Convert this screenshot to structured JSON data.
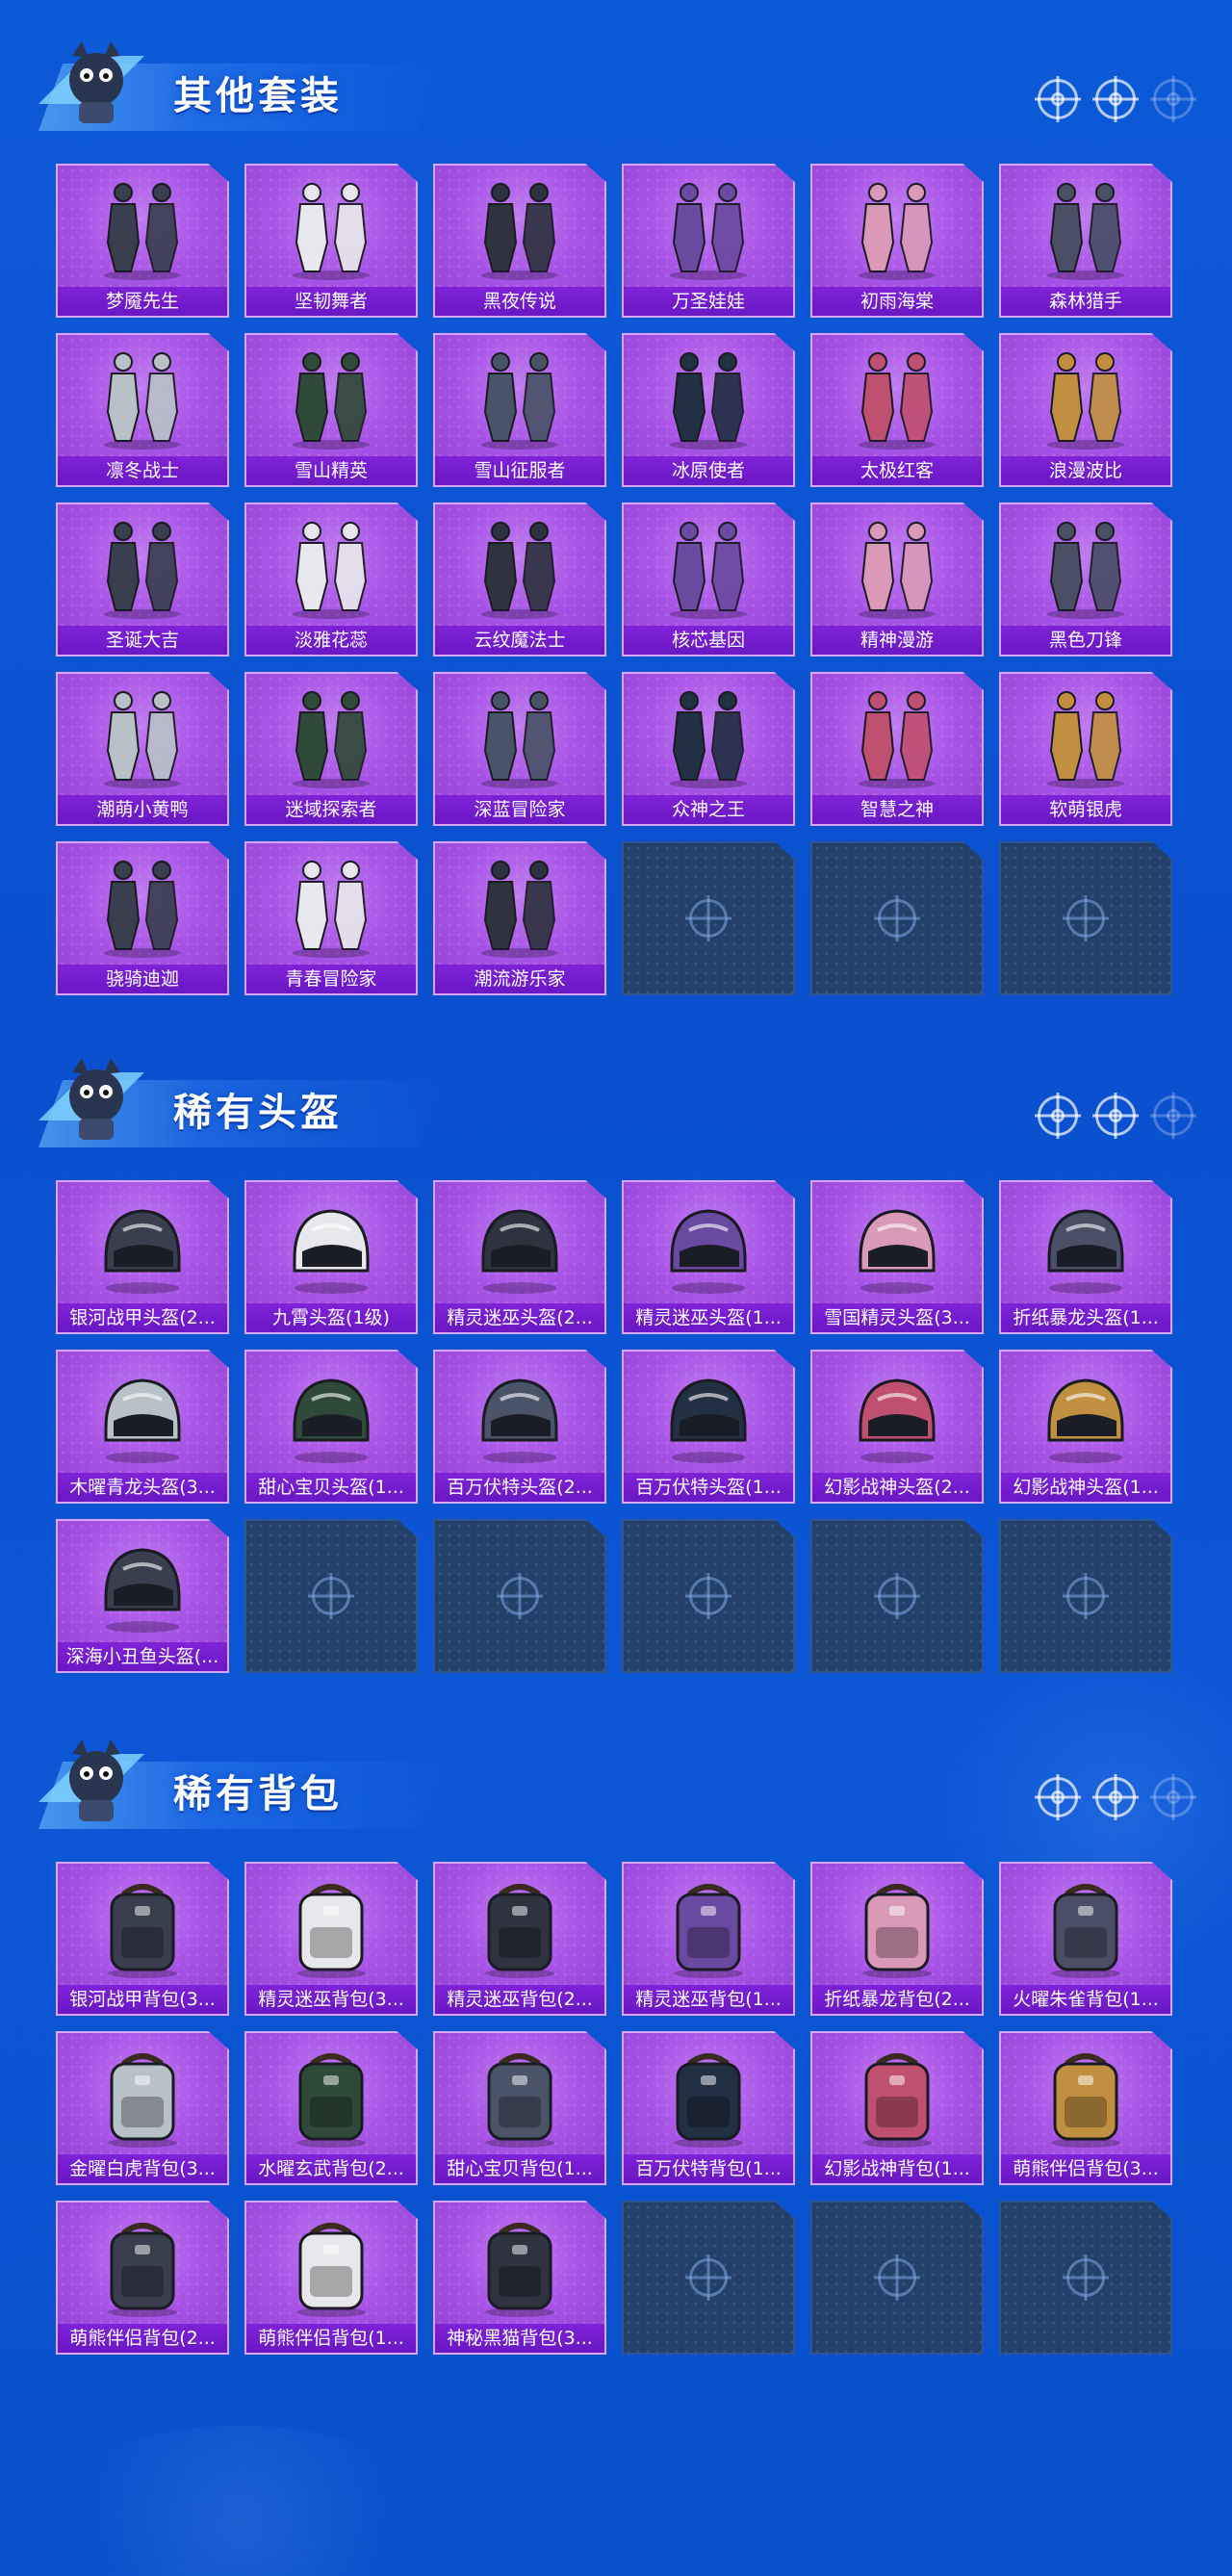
{
  "sections": [
    {
      "title": "其他套装",
      "items": [
        "梦魇先生",
        "坚韧舞者",
        "黑夜传说",
        "万圣娃娃",
        "初雨海棠",
        "森林猎手",
        "凛冬战士",
        "雪山精英",
        "雪山征服者",
        "冰原使者",
        "太极红客",
        "浪漫波比",
        "圣诞大吉",
        "淡雅花蕊",
        "云纹魔法士",
        "核芯基因",
        "精神漫游",
        "黑色刀锋",
        "潮萌小黄鸭",
        "迷域探索者",
        "深蓝冒险家",
        "众神之王",
        "智慧之神",
        "软萌银虎",
        "骁骑迪迦",
        "青春冒险家",
        "潮流游乐家"
      ],
      "empty_slots": 3,
      "item_icon": "outfit-icon"
    },
    {
      "title": "稀有头盔",
      "items": [
        "银河战甲头盔(2...",
        "九霄头盔(1级)",
        "精灵迷巫头盔(2...",
        "精灵迷巫头盔(1...",
        "雪国精灵头盔(3...",
        "折纸暴龙头盔(1...",
        "木曜青龙头盔(3...",
        "甜心宝贝头盔(1...",
        "百万伏特头盔(2...",
        "百万伏特头盔(1...",
        "幻影战神头盔(2...",
        "幻影战神头盔(1...",
        "深海小丑鱼头盔(..."
      ],
      "empty_slots": 5,
      "item_icon": "helmet-icon"
    },
    {
      "title": "稀有背包",
      "items": [
        "银河战甲背包(3...",
        "精灵迷巫背包(3...",
        "精灵迷巫背包(2...",
        "精灵迷巫背包(1...",
        "折纸暴龙背包(2...",
        "火曜朱雀背包(1...",
        "金曜白虎背包(3...",
        "水曜玄武背包(2...",
        "甜心宝贝背包(1...",
        "百万伏特背包(1...",
        "幻影战神背包(1...",
        "萌熊伴侣背包(3...",
        "萌熊伴侣背包(2...",
        "萌熊伴侣背包(1...",
        "神秘黑猫背包(3..."
      ],
      "empty_slots": 3,
      "item_icon": "backpack-icon"
    }
  ]
}
